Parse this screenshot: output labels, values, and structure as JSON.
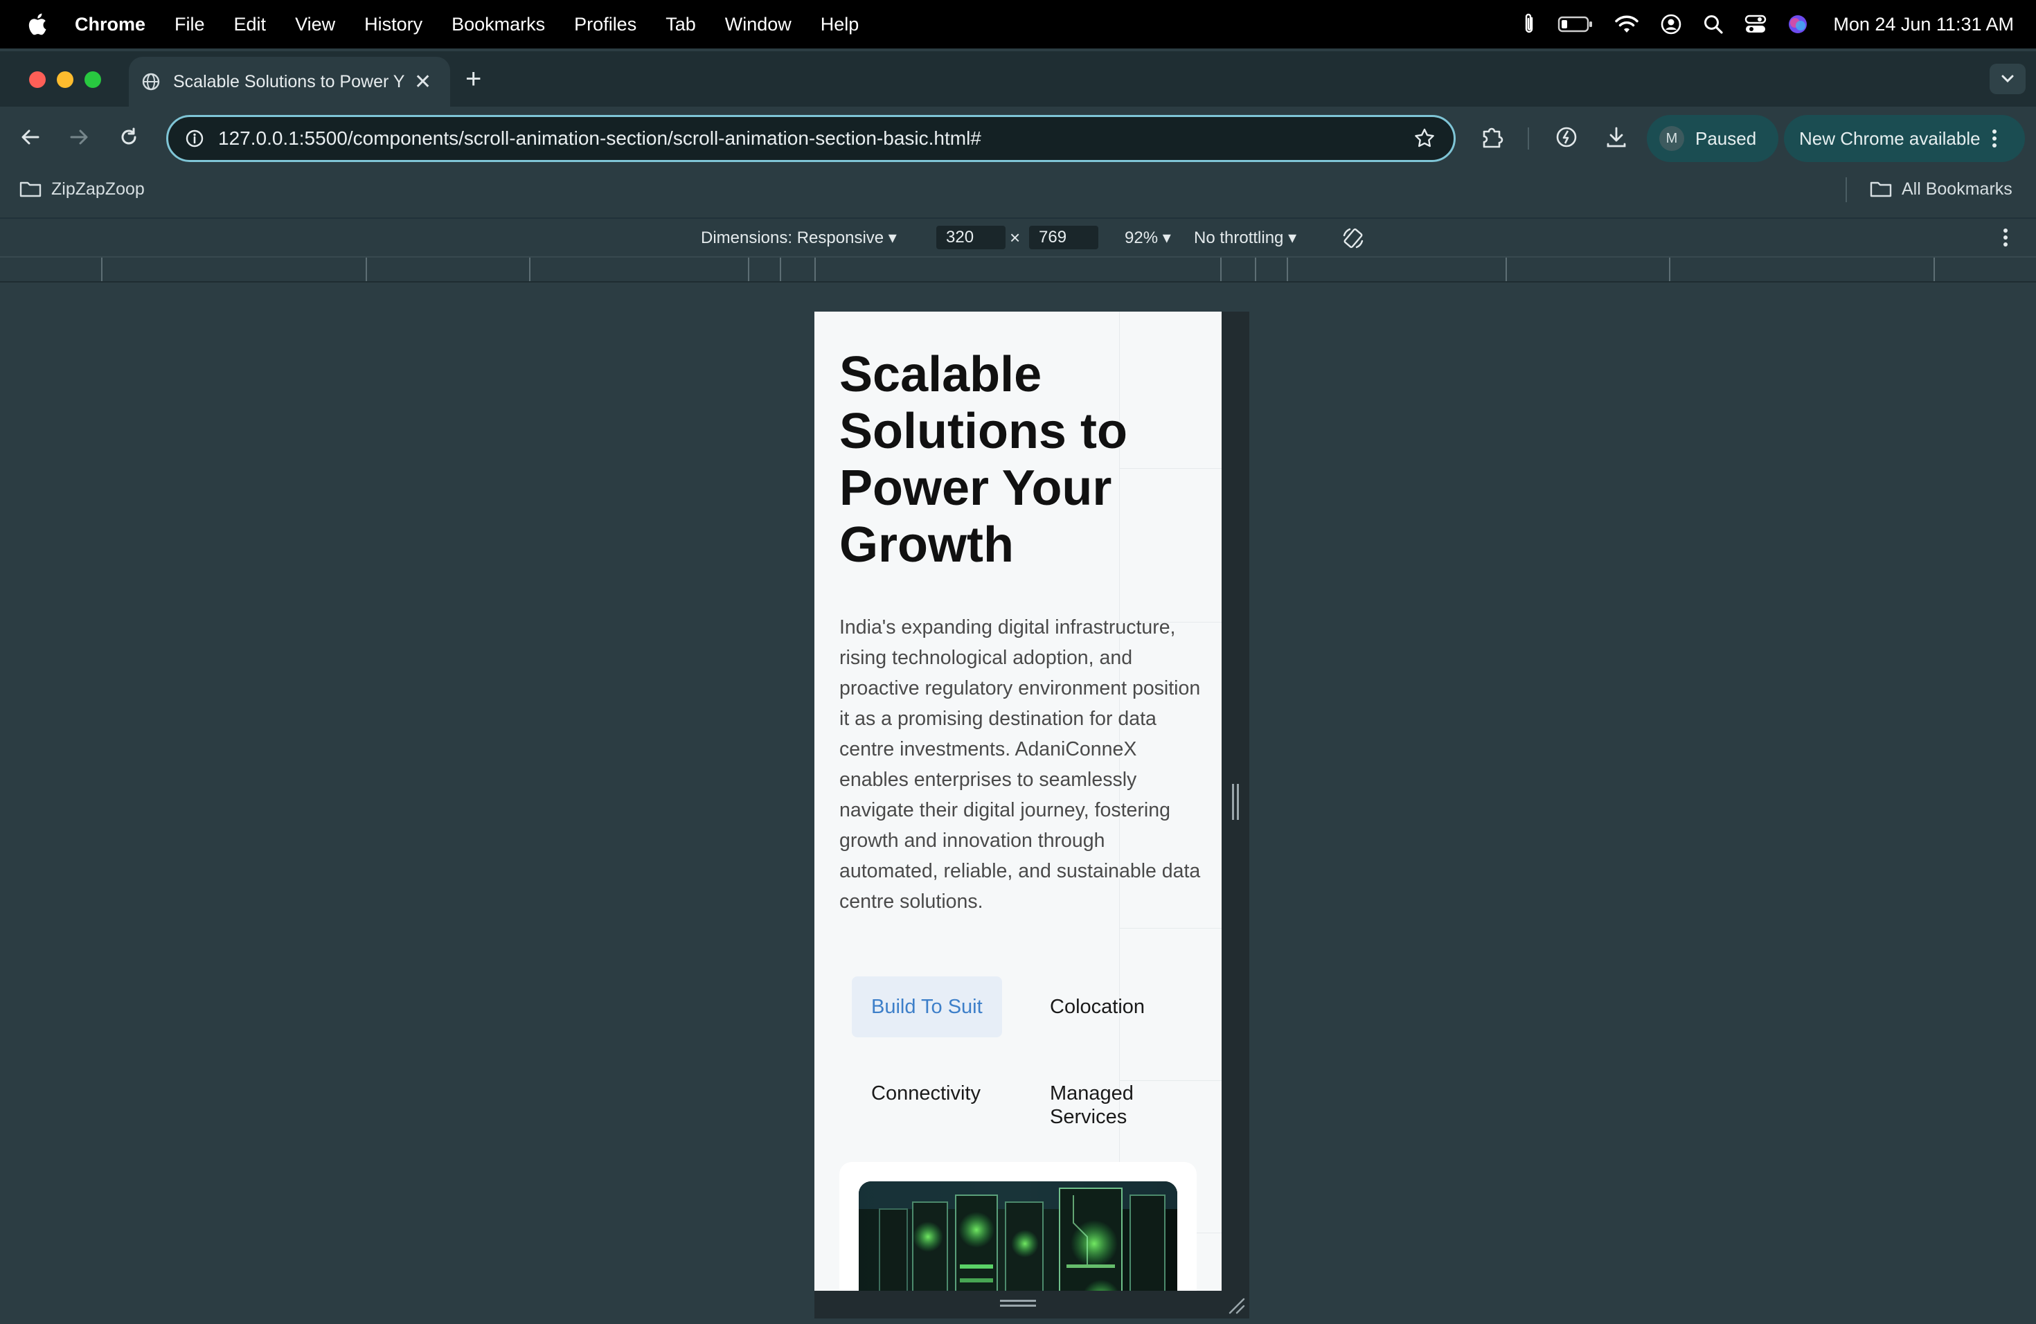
{
  "menubar": {
    "items": [
      "Chrome",
      "File",
      "Edit",
      "View",
      "History",
      "Bookmarks",
      "Profiles",
      "Tab",
      "Window",
      "Help"
    ],
    "clock": "Mon 24 Jun  11:31 AM"
  },
  "tab": {
    "title": "Scalable Solutions to Power Y",
    "new_tab_symbol": "+"
  },
  "omnibox": {
    "url": "127.0.0.1:5500/components/scroll-animation-section/scroll-animation-section-basic.html#"
  },
  "profile": {
    "initial": "M",
    "status": "Paused"
  },
  "update": {
    "label": "New Chrome available"
  },
  "bookmarks": {
    "folder": "ZipZapZoop",
    "all": "All Bookmarks"
  },
  "devtools": {
    "dimensions_label": "Dimensions: Responsive",
    "width": "320",
    "height": "769",
    "times": "×",
    "zoom": "92%",
    "throttling": "No throttling"
  },
  "page": {
    "headline": "Scalable Solutions to Power Your Growth",
    "intro": "India's expanding digital infrastructure, rising technological adoption, and proactive regulatory environment position it as a promising destination for data centre investments. AdaniConneX enables enterprises to seamlessly navigate their digital journey, fostering growth and innovation through automated, reliable, and sustainable data centre solutions.",
    "tabs": [
      {
        "label": "Build To Suit",
        "active": true
      },
      {
        "label": "Colocation",
        "active": false
      },
      {
        "label": "Connectivity",
        "active": false
      },
      {
        "label": "Managed Services",
        "active": false
      }
    ]
  },
  "colors": {
    "accent_tab": "#3d7fc9",
    "omnibox_focus": "#7fc5d6",
    "viewport_bg": "#f6f8f9"
  }
}
